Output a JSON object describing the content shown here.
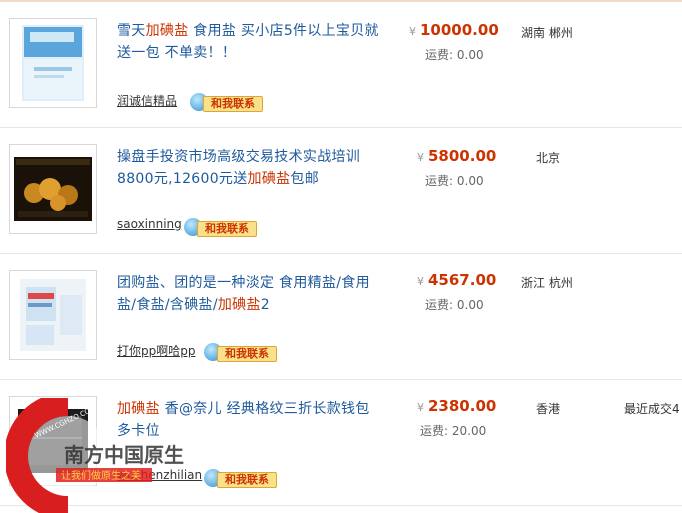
{
  "contact_label": "和我联系",
  "yen": "¥",
  "ship_label": "运费:",
  "listings": [
    {
      "title_parts": [
        {
          "t": "雪天",
          "kw": false
        },
        {
          "t": "加碘盐",
          "kw": true
        },
        {
          "t": " 食用盐 买小店5件以上宝贝就送一包 不单卖！！",
          "kw": false
        }
      ],
      "seller": "润诚信精品",
      "price": "10000.00",
      "shipping": "0.00",
      "location": "湖南 郴州"
    },
    {
      "title_parts": [
        {
          "t": "操盘手投资市场高级交易技术实战培训8800元,12600元送",
          "kw": false
        },
        {
          "t": "加碘盐",
          "kw": true
        },
        {
          "t": "包邮",
          "kw": false
        }
      ],
      "seller": "saoxinning",
      "price": "5800.00",
      "shipping": "0.00",
      "location": "北京"
    },
    {
      "title_parts": [
        {
          "t": "团购盐、团的是一种淡定 食用精盐/食用盐/食盐/含碘盐/",
          "kw": false
        },
        {
          "t": "加碘盐",
          "kw": true
        },
        {
          "t": "2",
          "kw": false
        }
      ],
      "seller": "打你pp啊哈pp",
      "price": "4567.00",
      "shipping": "0.00",
      "location": "浙江 杭州"
    },
    {
      "title_parts": [
        {
          "t": "加碘盐",
          "kw": true
        },
        {
          "t": " 香@奈儿 经典格纹三折长款钱包 多卡位",
          "kw": false
        }
      ],
      "seller": "wushenzhilian",
      "price": "2380.00",
      "shipping": "20.00",
      "location": "香港",
      "recent": "最近成交4"
    }
  ],
  "watermark": {
    "url": "WWW.CGHZO.COM",
    "name": "南方中国原生",
    "slogan": "让我们做原生之美"
  }
}
